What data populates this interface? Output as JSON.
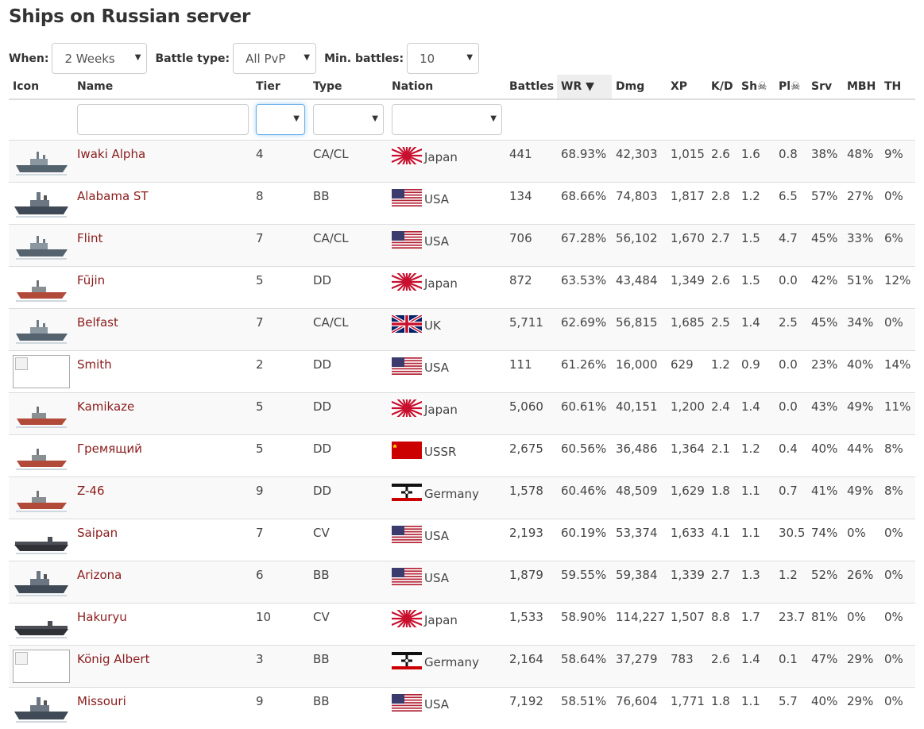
{
  "page": {
    "title": "Ships on Russian server"
  },
  "filters": {
    "when": {
      "label": "When:",
      "value": "2 Weeks"
    },
    "battle_type": {
      "label": "Battle type:",
      "value": "All PvP"
    },
    "min_battles": {
      "label": "Min. battles:",
      "value": "10"
    }
  },
  "columns": {
    "icon": "Icon",
    "name": "Name",
    "tier": "Tier",
    "type": "Type",
    "nation": "Nation",
    "battles": "Battles",
    "wr": "WR ▼",
    "dmg": "Dmg",
    "xp": "XP",
    "kd": "K/D",
    "sh": "Sh☠",
    "pl": "Pl☠",
    "srv": "Srv",
    "mbh": "MBH",
    "th": "TH"
  },
  "colors": {
    "link": "#8b1c1c",
    "sorted_header_bg": "#eeeeee",
    "stripe": "#f9f9f9",
    "border": "#dddddd"
  },
  "ships": [
    {
      "name": "Iwaki Alpha",
      "tier": "4",
      "type": "CA/CL",
      "nation": "Japan",
      "flag": "japan-flag",
      "icon": "cruiser-icon",
      "battles": "441",
      "wr": "68.93%",
      "dmg": "42,303",
      "xp": "1,015",
      "kd": "2.6",
      "sh": "1.6",
      "pl": "0.8",
      "srv": "38%",
      "mbh": "48%",
      "th": "9%"
    },
    {
      "name": "Alabama ST",
      "tier": "8",
      "type": "BB",
      "nation": "USA",
      "flag": "usa-flag",
      "icon": "battleship-icon",
      "battles": "134",
      "wr": "68.66%",
      "dmg": "74,803",
      "xp": "1,817",
      "kd": "2.8",
      "sh": "1.2",
      "pl": "6.5",
      "srv": "57%",
      "mbh": "27%",
      "th": "0%"
    },
    {
      "name": "Flint",
      "tier": "7",
      "type": "CA/CL",
      "nation": "USA",
      "flag": "usa-flag",
      "icon": "cruiser-icon",
      "battles": "706",
      "wr": "67.28%",
      "dmg": "56,102",
      "xp": "1,670",
      "kd": "2.7",
      "sh": "1.5",
      "pl": "4.7",
      "srv": "45%",
      "mbh": "33%",
      "th": "6%"
    },
    {
      "name": "Fūjin",
      "tier": "5",
      "type": "DD",
      "nation": "Japan",
      "flag": "japan-flag",
      "icon": "destroyer-icon",
      "battles": "872",
      "wr": "63.53%",
      "dmg": "43,484",
      "xp": "1,349",
      "kd": "2.6",
      "sh": "1.5",
      "pl": "0.0",
      "srv": "42%",
      "mbh": "51%",
      "th": "12%"
    },
    {
      "name": "Belfast",
      "tier": "7",
      "type": "CA/CL",
      "nation": "UK",
      "flag": "uk-flag",
      "icon": "cruiser-icon",
      "battles": "5,711",
      "wr": "62.69%",
      "dmg": "56,815",
      "xp": "1,685",
      "kd": "2.5",
      "sh": "1.4",
      "pl": "2.5",
      "srv": "45%",
      "mbh": "34%",
      "th": "0%"
    },
    {
      "name": "Smith",
      "tier": "2",
      "type": "DD",
      "nation": "USA",
      "flag": "usa-flag",
      "icon": "broken-image-icon",
      "battles": "111",
      "wr": "61.26%",
      "dmg": "16,000",
      "xp": "629",
      "kd": "1.2",
      "sh": "0.9",
      "pl": "0.0",
      "srv": "23%",
      "mbh": "40%",
      "th": "14%"
    },
    {
      "name": "Kamikaze",
      "tier": "5",
      "type": "DD",
      "nation": "Japan",
      "flag": "japan-flag",
      "icon": "destroyer-icon",
      "battles": "5,060",
      "wr": "60.61%",
      "dmg": "40,151",
      "xp": "1,200",
      "kd": "2.4",
      "sh": "1.4",
      "pl": "0.0",
      "srv": "43%",
      "mbh": "49%",
      "th": "11%"
    },
    {
      "name": "Гремящий",
      "tier": "5",
      "type": "DD",
      "nation": "USSR",
      "flag": "ussr-flag",
      "icon": "destroyer-icon",
      "battles": "2,675",
      "wr": "60.56%",
      "dmg": "36,486",
      "xp": "1,364",
      "kd": "2.1",
      "sh": "1.2",
      "pl": "0.4",
      "srv": "40%",
      "mbh": "44%",
      "th": "8%"
    },
    {
      "name": "Z-46",
      "tier": "9",
      "type": "DD",
      "nation": "Germany",
      "flag": "germany-flag",
      "icon": "destroyer-icon",
      "battles": "1,578",
      "wr": "60.46%",
      "dmg": "48,509",
      "xp": "1,629",
      "kd": "1.8",
      "sh": "1.1",
      "pl": "0.7",
      "srv": "41%",
      "mbh": "49%",
      "th": "8%"
    },
    {
      "name": "Saipan",
      "tier": "7",
      "type": "CV",
      "nation": "USA",
      "flag": "usa-flag",
      "icon": "carrier-icon",
      "battles": "2,193",
      "wr": "60.19%",
      "dmg": "53,374",
      "xp": "1,633",
      "kd": "4.1",
      "sh": "1.1",
      "pl": "30.5",
      "srv": "74%",
      "mbh": "0%",
      "th": "0%"
    },
    {
      "name": "Arizona",
      "tier": "6",
      "type": "BB",
      "nation": "USA",
      "flag": "usa-flag",
      "icon": "battleship-icon",
      "battles": "1,879",
      "wr": "59.55%",
      "dmg": "59,384",
      "xp": "1,339",
      "kd": "2.7",
      "sh": "1.3",
      "pl": "1.2",
      "srv": "52%",
      "mbh": "26%",
      "th": "0%"
    },
    {
      "name": "Hakuryu",
      "tier": "10",
      "type": "CV",
      "nation": "Japan",
      "flag": "japan-flag",
      "icon": "carrier-icon",
      "battles": "1,533",
      "wr": "58.90%",
      "dmg": "114,227",
      "xp": "1,507",
      "kd": "8.8",
      "sh": "1.7",
      "pl": "23.7",
      "srv": "81%",
      "mbh": "0%",
      "th": "0%"
    },
    {
      "name": "König Albert",
      "tier": "3",
      "type": "BB",
      "nation": "Germany",
      "flag": "germany-flag",
      "icon": "broken-image-icon",
      "battles": "2,164",
      "wr": "58.64%",
      "dmg": "37,279",
      "xp": "783",
      "kd": "2.6",
      "sh": "1.4",
      "pl": "0.1",
      "srv": "47%",
      "mbh": "29%",
      "th": "0%"
    },
    {
      "name": "Missouri",
      "tier": "9",
      "type": "BB",
      "nation": "USA",
      "flag": "usa-flag",
      "icon": "battleship-icon",
      "battles": "7,192",
      "wr": "58.51%",
      "dmg": "76,604",
      "xp": "1,771",
      "kd": "1.8",
      "sh": "1.1",
      "pl": "5.7",
      "srv": "40%",
      "mbh": "29%",
      "th": "0%"
    }
  ]
}
